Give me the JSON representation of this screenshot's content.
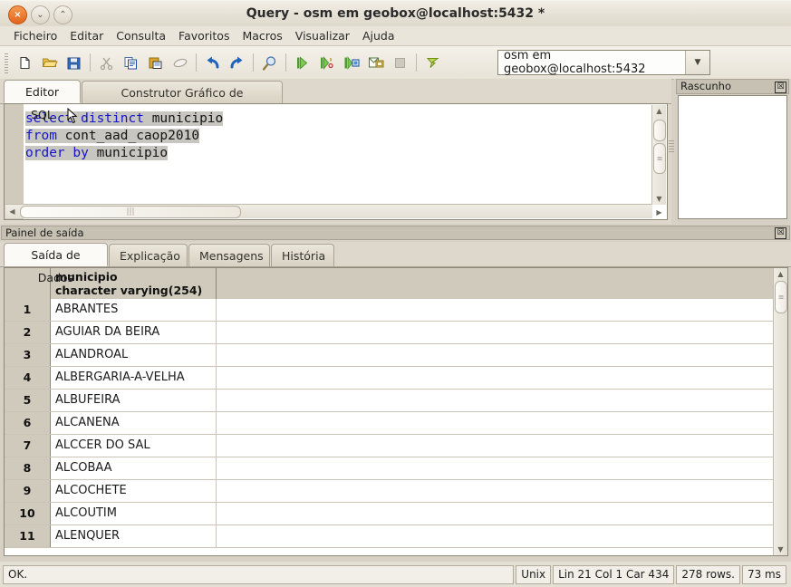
{
  "window": {
    "title": "Query - osm em geobox@localhost:5432 *",
    "buttons": {
      "close": "×",
      "minimize": "⌄",
      "maximize": "⌃"
    }
  },
  "menubar": {
    "items": [
      {
        "label": "Ficheiro"
      },
      {
        "label": "Editar"
      },
      {
        "label": "Consulta"
      },
      {
        "label": "Favoritos"
      },
      {
        "label": "Macros"
      },
      {
        "label": "Visualizar"
      },
      {
        "label": "Ajuda"
      }
    ]
  },
  "toolbar": {
    "icons": [
      {
        "name": "new-query-icon",
        "enabled": true
      },
      {
        "name": "open-file-icon",
        "enabled": true
      },
      {
        "name": "save-file-icon",
        "enabled": true
      },
      {
        "name": "cut-icon",
        "enabled": false
      },
      {
        "name": "copy-icon",
        "enabled": true
      },
      {
        "name": "paste-icon",
        "enabled": true
      },
      {
        "name": "clear-window-icon",
        "enabled": false
      },
      {
        "name": "undo-icon",
        "enabled": true
      },
      {
        "name": "redo-icon",
        "enabled": true
      },
      {
        "name": "find-replace-icon",
        "enabled": true
      },
      {
        "name": "execute-query-icon",
        "enabled": true
      },
      {
        "name": "explain-query-icon",
        "enabled": true
      },
      {
        "name": "execute-to-file-icon",
        "enabled": true
      },
      {
        "name": "explain-analyze-icon",
        "enabled": true
      },
      {
        "name": "stop-query-icon",
        "enabled": false
      },
      {
        "name": "favourites-icon",
        "enabled": true
      }
    ],
    "connection": {
      "value": "osm em geobox@localhost:5432",
      "dropdown_arrow": "▼"
    }
  },
  "editor": {
    "tabs": [
      {
        "label": "Editor SQL",
        "active": true
      },
      {
        "label": "Construtor Gráfico de Consultas",
        "active": false
      }
    ],
    "sql_lines": [
      [
        {
          "t": "select distinct ",
          "k": true
        },
        {
          "t": "municipio",
          "k": false
        }
      ],
      [
        {
          "t": "from ",
          "k": true
        },
        {
          "t": "cont_aad_caop2010",
          "k": false
        }
      ],
      [
        {
          "t": "order by ",
          "k": true
        },
        {
          "t": "municipio",
          "k": false
        }
      ]
    ],
    "scroll": {
      "up": "▲",
      "down": "▼",
      "left": "◀",
      "right": "▶",
      "grip": "≡"
    }
  },
  "scratchpad": {
    "title": "Rascunho",
    "close": "☒",
    "content": ""
  },
  "output": {
    "title": "Painel de saída",
    "close": "☒",
    "tabs": [
      {
        "label": "Saída de Dados",
        "active": true
      },
      {
        "label": "Explicação",
        "active": false
      },
      {
        "label": "Mensagens",
        "active": false
      },
      {
        "label": "História",
        "active": false
      }
    ],
    "grid": {
      "columns": [
        {
          "name": "",
          "type": ""
        },
        {
          "name": "municipio",
          "type": "character varying(254)"
        }
      ],
      "rows": [
        {
          "n": "1",
          "municipio": "ABRANTES"
        },
        {
          "n": "2",
          "municipio": "AGUIAR DA BEIRA"
        },
        {
          "n": "3",
          "municipio": "ALANDROAL"
        },
        {
          "n": "4",
          "municipio": "ALBERGARIA-A-VELHA"
        },
        {
          "n": "5",
          "municipio": "ALBUFEIRA"
        },
        {
          "n": "6",
          "municipio": "ALCANENA"
        },
        {
          "n": "7",
          "municipio": "ALCCER DO SAL"
        },
        {
          "n": "8",
          "municipio": "ALCOBAA"
        },
        {
          "n": "9",
          "municipio": "ALCOCHETE"
        },
        {
          "n": "10",
          "municipio": "ALCOUTIM"
        },
        {
          "n": "11",
          "municipio": "ALENQUER"
        }
      ]
    }
  },
  "statusbar": {
    "message": "OK.",
    "line_ending": "Unix",
    "position": "Lin 21 Col 1 Car 434",
    "rows": "278 rows.",
    "duration": "73 ms"
  },
  "colors": {
    "keyword": "#1414c8",
    "identifier": "#141414",
    "selection": "#c8c6c0",
    "titlebar_close": "#e2651d",
    "panel_header": "#c6c1b2"
  }
}
